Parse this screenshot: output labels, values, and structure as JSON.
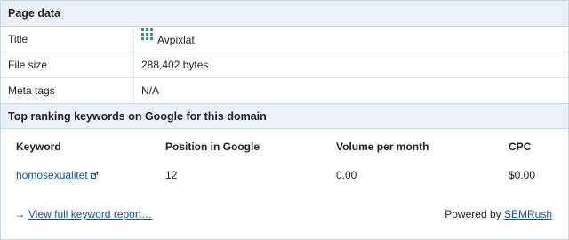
{
  "page_data": {
    "header": "Page data",
    "rows": [
      {
        "label": "Title",
        "value": "Avpixlat",
        "icon": "site-favicon-icon"
      },
      {
        "label": "File size",
        "value": "288,402 bytes"
      },
      {
        "label": "Meta tags",
        "value": "N/A"
      }
    ]
  },
  "keywords": {
    "header": "Top ranking keywords on Google for this domain",
    "columns": [
      "Keyword",
      "Position in Google",
      "Volume per month",
      "CPC"
    ],
    "rows": [
      {
        "keyword": "homosexualitet",
        "position": "12",
        "volume": "0.00",
        "cpc": "$0.00"
      }
    ],
    "full_report_arrow": "→",
    "full_report_link": "View full keyword report…",
    "powered_by_text": "Powered by",
    "powered_by_link": "SEMRush"
  },
  "colors": {
    "link": "#1a4f8a",
    "header_bg": "#eaf1f8",
    "border": "#c9d6e3"
  }
}
